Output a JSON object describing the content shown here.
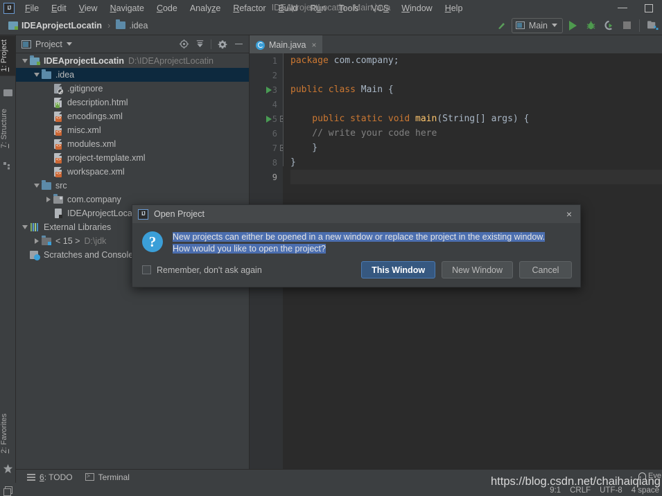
{
  "titlebar": {
    "logo": "IJ",
    "window_title": "IDEAprojectLocatin - Main.java",
    "menu": [
      {
        "pre": "",
        "u": "F",
        "post": "ile"
      },
      {
        "pre": "",
        "u": "E",
        "post": "dit"
      },
      {
        "pre": "",
        "u": "V",
        "post": "iew"
      },
      {
        "pre": "",
        "u": "N",
        "post": "avigate"
      },
      {
        "pre": "",
        "u": "C",
        "post": "ode"
      },
      {
        "pre": "Analy",
        "u": "z",
        "post": "e"
      },
      {
        "pre": "",
        "u": "R",
        "post": "efactor"
      },
      {
        "pre": "",
        "u": "B",
        "post": "uild"
      },
      {
        "pre": "R",
        "u": "u",
        "post": "n"
      },
      {
        "pre": "",
        "u": "T",
        "post": "ools"
      },
      {
        "pre": "VC",
        "u": "S",
        "post": ""
      },
      {
        "pre": "",
        "u": "W",
        "post": "indow"
      },
      {
        "pre": "",
        "u": "H",
        "post": "elp"
      }
    ],
    "minimize_label": "Minimize",
    "maximize_label": "Maximize"
  },
  "navbar": {
    "breadcrumbs": [
      {
        "label": "IDEAprojectLocatin",
        "bold": true,
        "icon": "module-icon"
      },
      {
        "label": ".idea",
        "bold": false,
        "icon": "folder-icon"
      }
    ],
    "separator": "›",
    "run_config": "Main",
    "buttons": {
      "build": "Build",
      "run": "Run",
      "debug": "Debug",
      "run_coverage": "Run with Coverage",
      "stop": "Stop",
      "project_structure": "Project Structure"
    }
  },
  "left_strip": {
    "tabs": [
      {
        "num": "1",
        "label": ": Project",
        "active": true
      },
      {
        "num": "7",
        "label": ": Structure",
        "active": false
      },
      {
        "num": "2",
        "label": ": Favorites",
        "active": false
      }
    ]
  },
  "project_panel": {
    "title": "Project",
    "actions": [
      "locate-icon",
      "collapse-all-icon",
      "settings-icon",
      "hide-icon"
    ],
    "tree": [
      {
        "indent": 0,
        "arrow": "down",
        "icon": "module-root",
        "label": "IDEAprojectLocatin",
        "bold": true,
        "path": "D:\\IDEAprojectLocatin",
        "selected": false
      },
      {
        "indent": 1,
        "arrow": "down",
        "icon": "folder",
        "label": ".idea",
        "bold": false,
        "path": "",
        "selected": true
      },
      {
        "indent": 2,
        "arrow": "none",
        "icon": "gitignore",
        "label": ".gitignore",
        "bold": false,
        "path": "",
        "selected": false
      },
      {
        "indent": 2,
        "arrow": "none",
        "icon": "html",
        "label": "description.html",
        "bold": false,
        "path": "",
        "selected": false
      },
      {
        "indent": 2,
        "arrow": "none",
        "icon": "xml",
        "label": "encodings.xml",
        "bold": false,
        "path": "",
        "selected": false
      },
      {
        "indent": 2,
        "arrow": "none",
        "icon": "xml",
        "label": "misc.xml",
        "bold": false,
        "path": "",
        "selected": false
      },
      {
        "indent": 2,
        "arrow": "none",
        "icon": "xml",
        "label": "modules.xml",
        "bold": false,
        "path": "",
        "selected": false
      },
      {
        "indent": 2,
        "arrow": "none",
        "icon": "xml",
        "label": "project-template.xml",
        "bold": false,
        "path": "",
        "selected": false
      },
      {
        "indent": 2,
        "arrow": "none",
        "icon": "xml",
        "label": "workspace.xml",
        "bold": false,
        "path": "",
        "selected": false
      },
      {
        "indent": 1,
        "arrow": "down",
        "icon": "folder",
        "label": "src",
        "bold": false,
        "path": "",
        "selected": false
      },
      {
        "indent": 2,
        "arrow": "right",
        "icon": "package",
        "label": "com.company",
        "bold": false,
        "path": "",
        "selected": false
      },
      {
        "indent": 2,
        "arrow": "none",
        "icon": "iml",
        "label": "IDEAprojectLocatin.iml",
        "bold": false,
        "path": "",
        "selected": false
      },
      {
        "indent": 0,
        "arrow": "down",
        "icon": "libraries",
        "label": "External Libraries",
        "bold": false,
        "path": "",
        "selected": false
      },
      {
        "indent": 1,
        "arrow": "right",
        "icon": "jdk",
        "label": "< 15 >",
        "bold": false,
        "path": "D:\\jdk",
        "selected": false
      },
      {
        "indent": 0,
        "arrow": "none",
        "icon": "scratches",
        "label": "Scratches and Consoles",
        "bold": false,
        "path": "",
        "selected": false
      }
    ]
  },
  "editor": {
    "tab": {
      "label": "Main.java",
      "close": "×",
      "icon": "java-class-icon"
    },
    "lines": [
      {
        "num": "1",
        "run": false,
        "fold": "none",
        "current": false,
        "tokens": [
          {
            "t": "package ",
            "c": "kw"
          },
          {
            "t": "com.company;",
            "c": "plain"
          }
        ]
      },
      {
        "num": "2",
        "run": false,
        "fold": "none",
        "current": false,
        "tokens": []
      },
      {
        "num": "3",
        "run": true,
        "fold": "none",
        "current": false,
        "tokens": [
          {
            "t": "public class ",
            "c": "kw"
          },
          {
            "t": "Main {",
            "c": "plain"
          }
        ]
      },
      {
        "num": "4",
        "run": false,
        "fold": "none",
        "current": false,
        "tokens": []
      },
      {
        "num": "5",
        "run": true,
        "fold": "open",
        "current": false,
        "tokens": [
          {
            "t": "    public static void ",
            "c": "kw"
          },
          {
            "t": "main",
            "c": "fn"
          },
          {
            "t": "(String[] args) {",
            "c": "plain"
          }
        ]
      },
      {
        "num": "6",
        "run": false,
        "fold": "none",
        "current": false,
        "tokens": [
          {
            "t": "    // write your code here",
            "c": "cmt"
          }
        ]
      },
      {
        "num": "7",
        "run": false,
        "fold": "close",
        "current": false,
        "tokens": [
          {
            "t": "    }",
            "c": "plain"
          }
        ]
      },
      {
        "num": "8",
        "run": false,
        "fold": "none",
        "current": false,
        "tokens": [
          {
            "t": "}",
            "c": "plain"
          }
        ]
      },
      {
        "num": "9",
        "run": false,
        "fold": "none",
        "current": true,
        "tokens": []
      }
    ]
  },
  "dialog": {
    "logo": "IJ",
    "title": "Open Project",
    "close": "×",
    "message_line1": "New projects can either be opened in a new window or replace the project in the existing window.",
    "message_line2": "How would you like to open the project?",
    "checkbox_label": "Remember, don't ask again",
    "checkbox_checked": false,
    "buttons": [
      {
        "label": "This Window",
        "primary": true
      },
      {
        "label": "New Window",
        "primary": false
      },
      {
        "label": "Cancel",
        "primary": false
      }
    ],
    "accent_selection_color": "#4b6eaf",
    "primary_button_color": "#365880"
  },
  "bottom_bar": {
    "items": [
      {
        "num": "6",
        "label": ": TODO",
        "icon": "todo-icon"
      },
      {
        "num": "",
        "label": "Terminal",
        "icon": "terminal-icon"
      }
    ]
  },
  "status_bar": {
    "caret": "9:1",
    "line_separator": "CRLF",
    "encoding": "UTF-8",
    "indent": "4 space",
    "event_log": "Eve",
    "window_icon": "split-window-icon"
  },
  "watermark": {
    "text": "https://blog.csdn.net/chaihaiqiang"
  }
}
